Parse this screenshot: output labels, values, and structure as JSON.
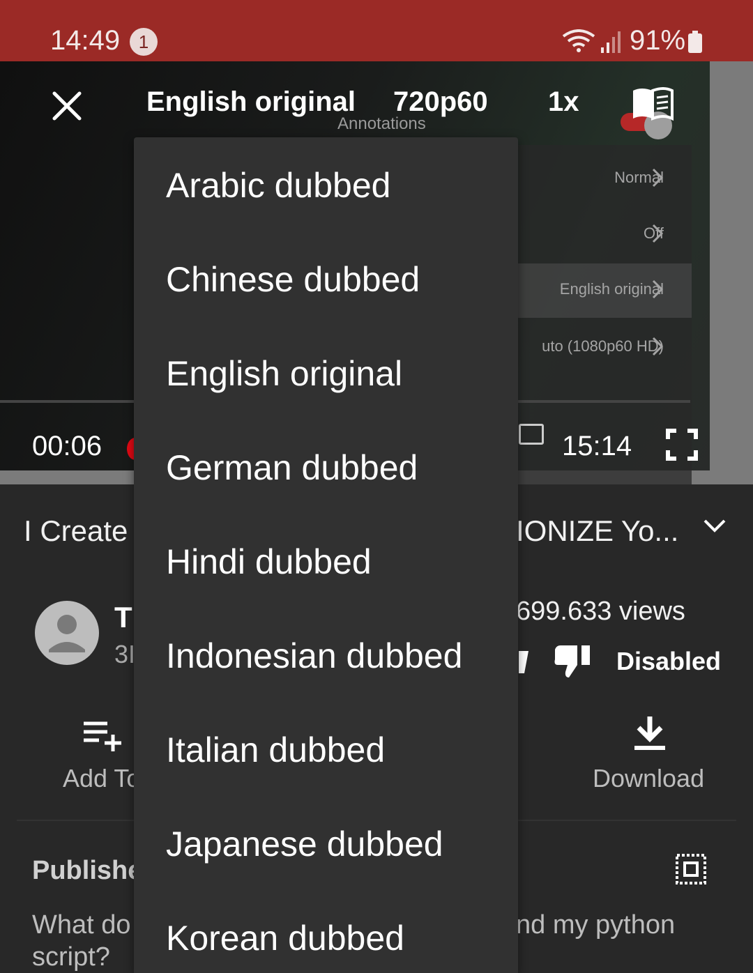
{
  "status_bar": {
    "time": "14:49",
    "notification_count": "1",
    "battery": "91%"
  },
  "player": {
    "audio_track": "English original",
    "quality": "720p60",
    "speed": "1x",
    "current_time": "00:06",
    "total_time": "15:14",
    "settings_background": {
      "annotations_label": "Annotations",
      "rows": [
        "Normal",
        "Off",
        "English original",
        "Auto (1080p60 HD)"
      ],
      "visible_rows": [
        "Normal",
        "Off",
        "English original",
        "uto (1080p60 HD)"
      ]
    }
  },
  "audio_menu": {
    "items": [
      "Arabic dubbed",
      "Chinese dubbed",
      "English original",
      "German dubbed",
      "Hindi dubbed",
      "Indonesian dubbed",
      "Italian dubbed",
      "Japanese dubbed",
      "Korean dubbed"
    ]
  },
  "video": {
    "title_start": "I Create",
    "title_end": "IONIZE Yo...",
    "channel_initial": "T",
    "subscribers_partial": "3I",
    "views": "699.633 views",
    "dislike_label": "Disabled"
  },
  "actions": {
    "add_to_partial": "Add To",
    "download": "Download"
  },
  "description": {
    "published_partial": "Publishe",
    "line1_start": "What do",
    "line1_end": "nd my python",
    "line2_start": "script?"
  },
  "colors": {
    "status_bar": "#9b2a26",
    "menu_bg": "#313131",
    "page_bg": "#282828",
    "accent_red": "#e50914"
  },
  "icons": [
    "close-icon",
    "book-icon",
    "fullscreen-icon",
    "expand-icon",
    "dislike-icon",
    "add-to-playlist-icon",
    "download-icon",
    "wifi-icon",
    "signal-icon",
    "battery-icon"
  ]
}
